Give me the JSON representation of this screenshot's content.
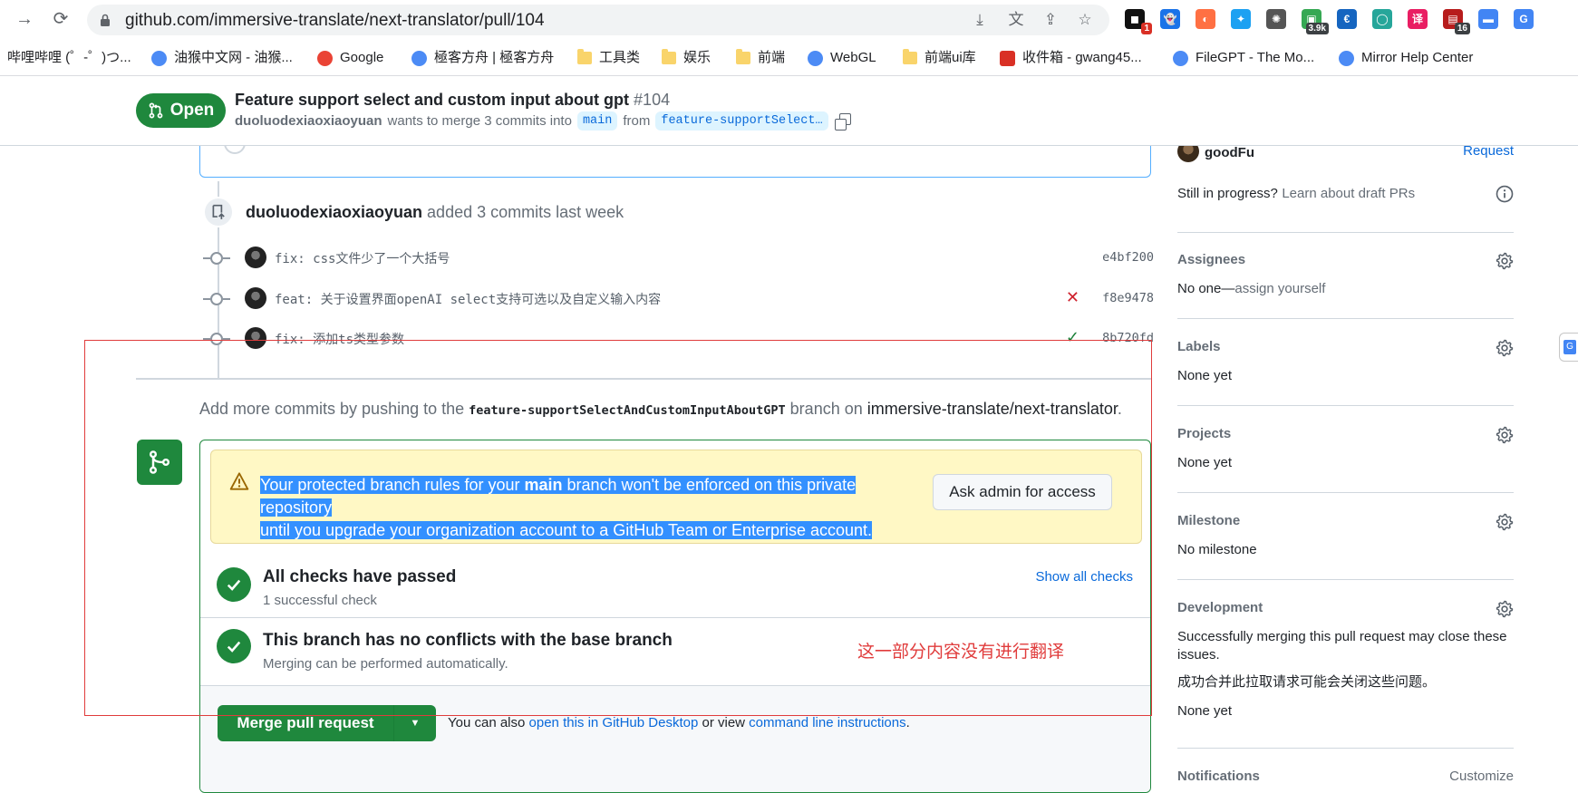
{
  "browser": {
    "url": "github.com/immersive-translate/next-translator/pull/104",
    "extensions": [
      {
        "name": "tampermonkey-ext",
        "color": "#111111",
        "badge": "1",
        "badge_color": "#d93025"
      },
      {
        "name": "ghost-ext",
        "color": "#1a73e8",
        "badge": "",
        "badge_color": ""
      },
      {
        "name": "flame-ext",
        "color": "#ff7043",
        "badge": "",
        "badge_color": ""
      },
      {
        "name": "bird-ext",
        "color": "#1da1f2",
        "badge": "",
        "badge_color": ""
      },
      {
        "name": "openai-ext",
        "color": "#555555",
        "badge": "",
        "badge_color": ""
      },
      {
        "name": "counter-ext",
        "color": "#35a853",
        "badge": "3.9k",
        "badge_color": "#3c4043"
      },
      {
        "name": "euro-ext",
        "color": "#1565c0",
        "badge": "",
        "badge_color": ""
      },
      {
        "name": "chat-ext",
        "color": "#26a69a",
        "badge": "",
        "badge_color": ""
      },
      {
        "name": "translate-ext",
        "color": "#e91e63",
        "badge": "",
        "badge_color": ""
      },
      {
        "name": "reader-ext",
        "color": "#b71c1c",
        "badge": "16",
        "badge_color": "#3c4043"
      },
      {
        "name": "folder-ext",
        "color": "#4285f4",
        "badge": "",
        "badge_color": ""
      },
      {
        "name": "gtranslate-ext",
        "color": "#4285f4",
        "badge": "",
        "badge_color": ""
      }
    ],
    "bookmarks": [
      {
        "label": "哔哩哔哩 (゜-゜)つ...",
        "icon": "none"
      },
      {
        "label": "油猴中文网 - 油猴...",
        "icon": "site"
      },
      {
        "label": "Google",
        "icon": "google"
      },
      {
        "label": "極客方舟 | 極客方舟",
        "icon": "site"
      },
      {
        "label": "工具类",
        "icon": "folder"
      },
      {
        "label": "娱乐",
        "icon": "folder"
      },
      {
        "label": "前端",
        "icon": "folder"
      },
      {
        "label": "WebGL",
        "icon": "site"
      },
      {
        "label": "前端ui库",
        "icon": "folder"
      },
      {
        "label": "收件箱 - gwang45...",
        "icon": "gmail"
      },
      {
        "label": "FileGPT - The Mo...",
        "icon": "site"
      },
      {
        "label": "Mirror Help Center",
        "icon": "site"
      }
    ]
  },
  "pr": {
    "state": "Open",
    "title": "Feature support select and custom input about gpt",
    "number": "#104",
    "author": "duoluodexiaoxiaoyuan",
    "merge_text": "wants to merge 3 commits into",
    "base_branch": "main",
    "from_text": "from",
    "head_branch_short": "feature-supportSelect…"
  },
  "timeline": {
    "push_author": "duoluodexiaoxiaoyuan",
    "push_text": "added 3 commits last week",
    "commits": [
      {
        "message": "fix: css文件少了一个大括号",
        "sha": "e4bf200",
        "status": ""
      },
      {
        "message": "feat: 关于设置界面openAI select支持可选以及自定义输入内容",
        "sha": "f8e9478",
        "status": "fail"
      },
      {
        "message": "fix: 添加ts类型参数",
        "sha": "8b720fd",
        "status": "pass"
      }
    ],
    "add_more_prefix": "Add more commits by pushing to the",
    "add_more_branch": "feature-supportSelectAndCustomInputAboutGPT",
    "add_more_mid": "branch on",
    "add_more_repo": "immersive-translate/next-translator",
    "add_more_suffix": "."
  },
  "merge_box": {
    "warning_line1_a": "Your protected branch rules for your ",
    "warning_line1_b": "main",
    "warning_line1_c": " branch won't be enforced on this private repository",
    "warning_line2": "until you upgrade your organization account to a GitHub Team or Enterprise account.",
    "admin_button": "Ask admin for access",
    "checks_title": "All checks have passed",
    "checks_sub": "1 successful check",
    "show_checks": "Show all checks",
    "conflicts_title": "This branch has no conflicts with the base branch",
    "conflicts_sub": "Merging can be performed automatically.",
    "merge_button": "Merge pull request",
    "note_prefix": "You can also",
    "note_link1": "open this in GitHub Desktop",
    "note_mid": "or view",
    "note_link2": "command line instructions",
    "note_suffix": "."
  },
  "annotation": {
    "note": "这一部分内容没有进行翻译",
    "color": "#e03c3c"
  },
  "sidebar": {
    "reviewer_name": "goodFu",
    "reviewer_action": "Request",
    "draft_prefix": "Still in progress?",
    "draft_link": "Learn about draft PRs",
    "assignees_title": "Assignees",
    "assignees_value": "No one—",
    "assignees_link": "assign yourself",
    "labels_title": "Labels",
    "labels_value": "None yet",
    "projects_title": "Projects",
    "projects_value": "None yet",
    "milestone_title": "Milestone",
    "milestone_value": "No milestone",
    "development_title": "Development",
    "development_text": "Successfully merging this pull request may close these issues.",
    "development_translated": "成功合并此拉取请求可能会关闭这些问题。",
    "development_value": "None yet",
    "notifications_title": "Notifications",
    "notifications_action": "Customize"
  },
  "colors": {
    "accent_green": "#1f883d",
    "link_blue": "#0969da",
    "warning_bg": "#fff8c5",
    "selection": "#3390ff"
  }
}
